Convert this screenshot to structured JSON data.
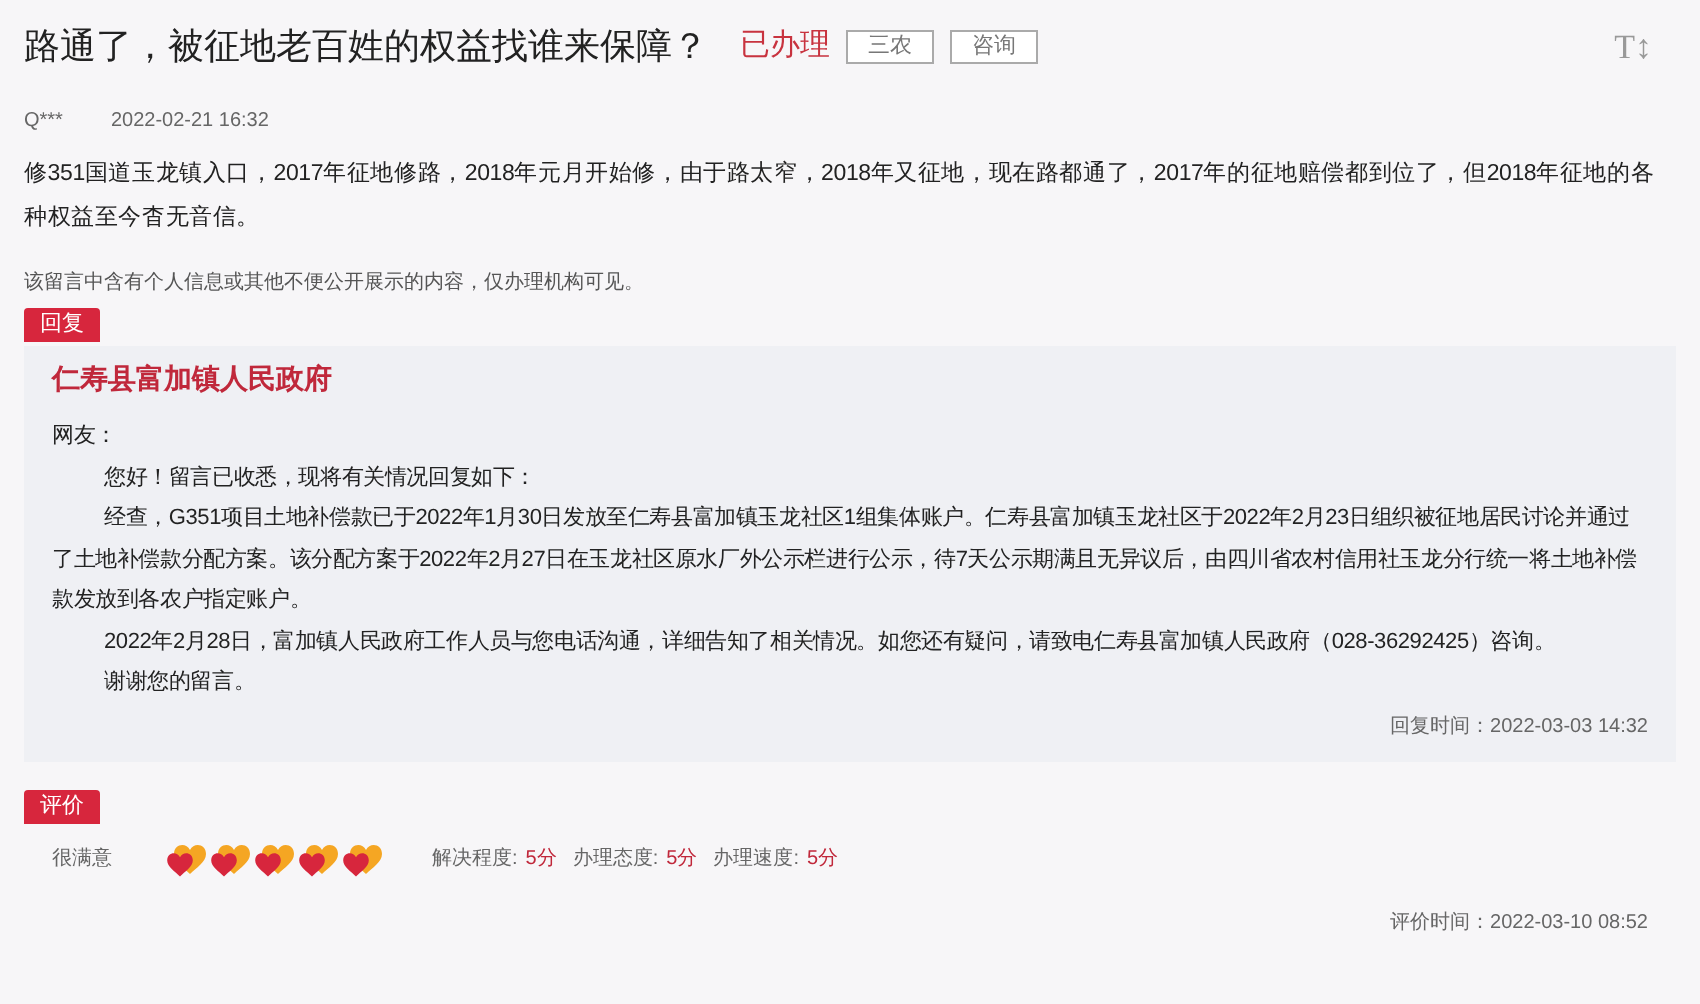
{
  "question": {
    "title": "路通了，被征地老百姓的权益找谁来保障？",
    "status": "已办理",
    "tags": [
      "三农",
      "咨询"
    ],
    "font_toggle": "T↕",
    "author": "Q***",
    "time": "2022-02-21 16:32",
    "body": "修351国道玉龙镇入口，2017年征地修路，2018年元月开始修，由于路太窄，2018年又征地，现在路都通了，2017年的征地赔偿都到位了，但2018年征地的各种权益至今杳无音信。",
    "notice": "该留言中含有个人信息或其他不便公开展示的内容，仅办理机构可见。"
  },
  "reply": {
    "label": "回复",
    "org": "仁寿县富加镇人民政府",
    "greeting": "网友：",
    "paragraphs": [
      "您好！留言已收悉，现将有关情况回复如下：",
      "经查，G351项目土地补偿款已于2022年1月30日发放至仁寿县富加镇玉龙社区1组集体账户。仁寿县富加镇玉龙社区于2022年2月23日组织被征地居民讨论并通过了土地补偿款分配方案。该分配方案于2022年2月27日在玉龙社区原水厂外公示栏进行公示，待7天公示期满且无异议后，由四川省农村信用社玉龙分行统一将土地补偿款发放到各农户指定账户。",
      "2022年2月28日，富加镇人民政府工作人员与您电话沟通，详细告知了相关情况。如您还有疑问，请致电仁寿县富加镇人民政府（028-36292425）咨询。",
      "谢谢您的留言。"
    ],
    "time": "回复时间：2022-03-03 14:32"
  },
  "evaluation": {
    "label": "评价",
    "rating": "很满意",
    "stars": 5,
    "metrics": [
      {
        "label": "解决程度:",
        "value": "5分"
      },
      {
        "label": "办理态度:",
        "value": "5分"
      },
      {
        "label": "办理速度:",
        "value": "5分"
      }
    ],
    "time": "评价时间：2022-03-10 08:52"
  }
}
